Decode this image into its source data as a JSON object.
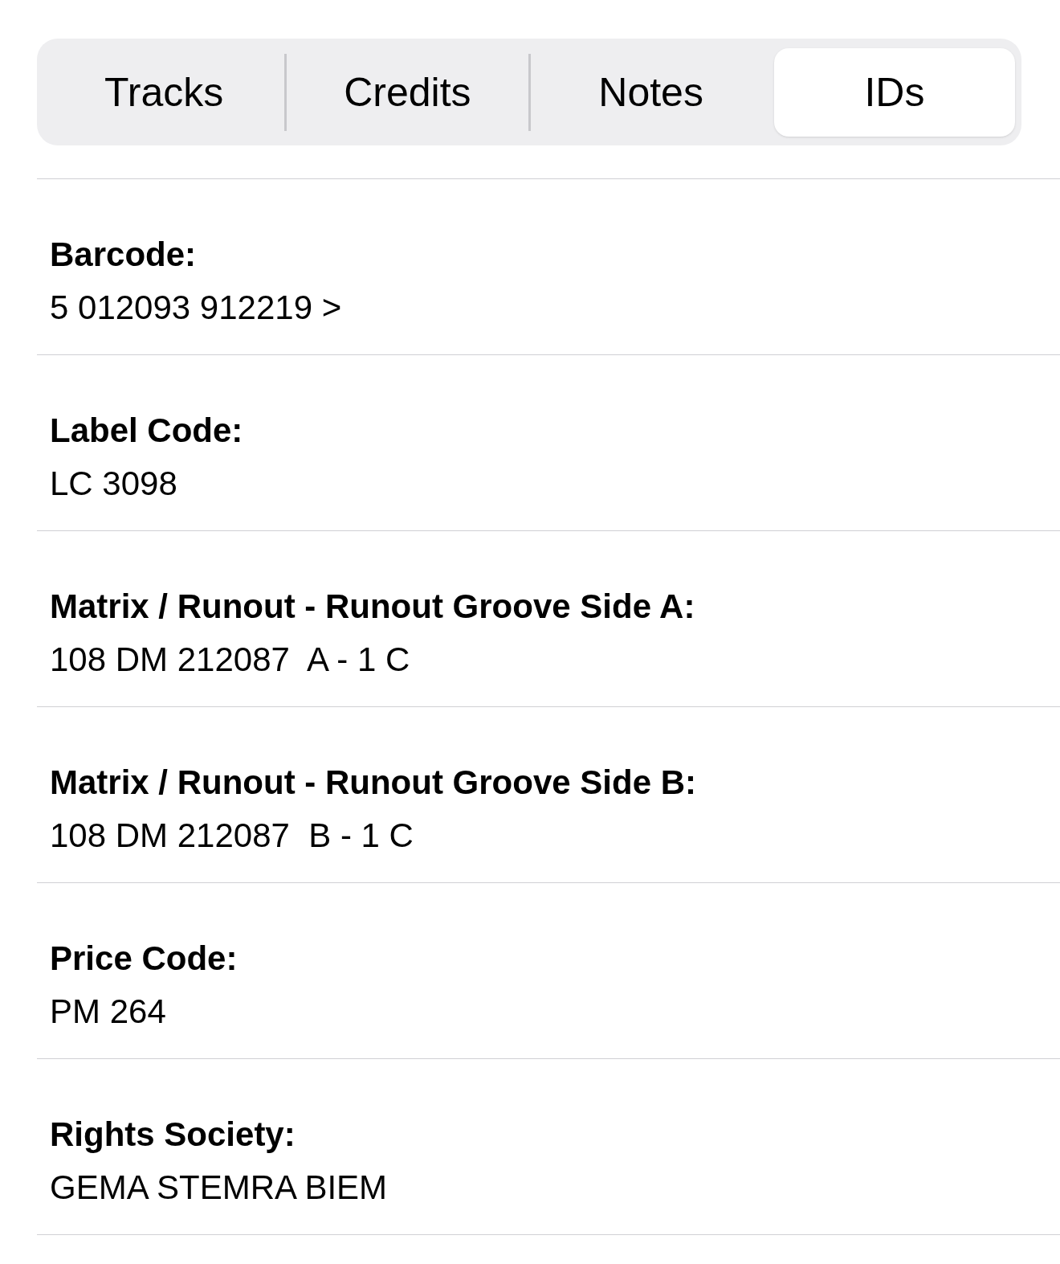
{
  "tabs": [
    {
      "label": "Tracks",
      "selected": false
    },
    {
      "label": "Credits",
      "selected": false
    },
    {
      "label": "Notes",
      "selected": false
    },
    {
      "label": "IDs",
      "selected": true
    }
  ],
  "identifiers": [
    {
      "label": "Barcode:",
      "value": "5 012093 912219 >"
    },
    {
      "label": "Label Code:",
      "value": "LC 3098"
    },
    {
      "label": "Matrix / Runout - Runout Groove Side A:",
      "value": "108 DM 212087  A - 1 C"
    },
    {
      "label": "Matrix / Runout - Runout Groove Side B:",
      "value": "108 DM 212087  B - 1 C"
    },
    {
      "label": "Price Code:",
      "value": "PM 264"
    },
    {
      "label": "Rights Society:",
      "value": "GEMA STEMRA BIEM"
    }
  ]
}
